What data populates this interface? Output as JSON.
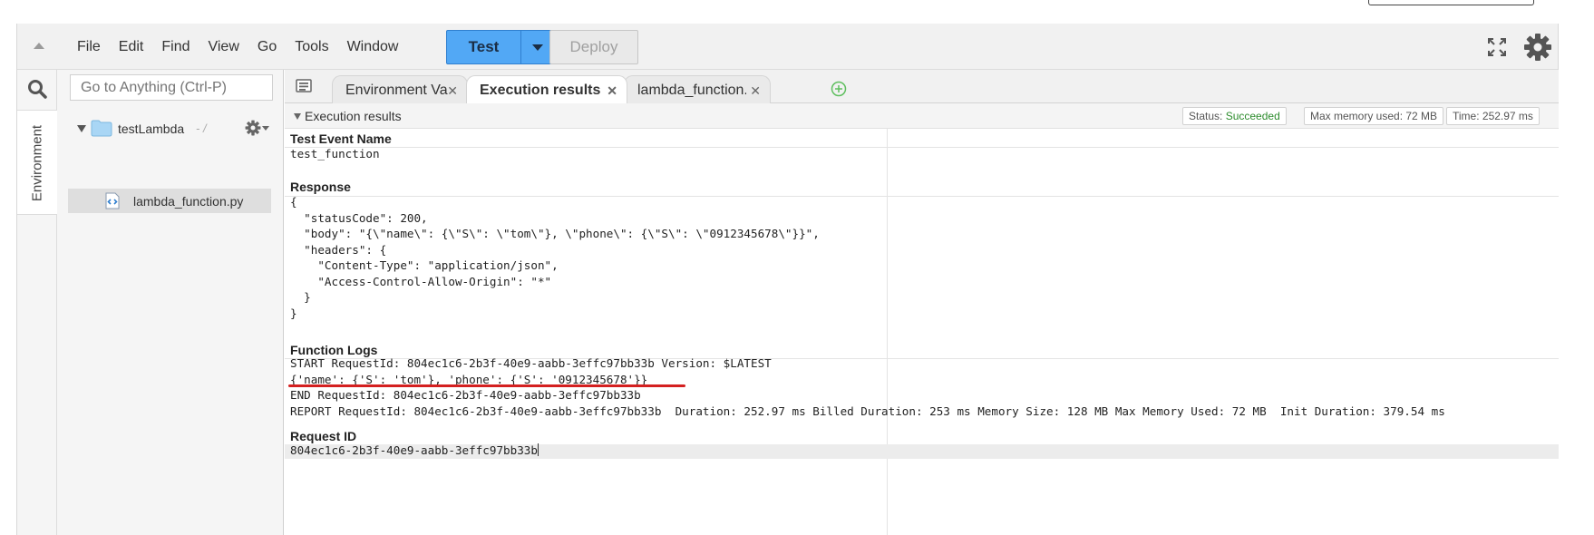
{
  "menubar": {
    "items": [
      "File",
      "Edit",
      "Find",
      "View",
      "Go",
      "Tools",
      "Window"
    ],
    "test_label": "Test",
    "deploy_label": "Deploy"
  },
  "rail": {
    "environment_tab": "Environment"
  },
  "tree": {
    "goto_placeholder": "Go to Anything (Ctrl-P)",
    "root_name": "testLambda",
    "root_sep": "- /",
    "file_name": "lambda_function.py"
  },
  "tabs": [
    {
      "label": "Environment Vari",
      "active": false
    },
    {
      "label": "Execution results",
      "active": true
    },
    {
      "label": "lambda_function.",
      "active": false
    }
  ],
  "results": {
    "title": "Execution results",
    "status_label": "Status:",
    "status_value": "Succeeded",
    "memory": "Max memory used: 72 MB",
    "time": "Time: 252.97 ms"
  },
  "sections": {
    "test_event_name_title": "Test Event Name",
    "test_event_name_value": "test_function",
    "response_title": "Response",
    "response_body": "{\n  \"statusCode\": 200,\n  \"body\": \"{\\\"name\\\": {\\\"S\\\": \\\"tom\\\"}, \\\"phone\\\": {\\\"S\\\": \\\"0912345678\\\"}}\",\n  \"headers\": {\n    \"Content-Type\": \"application/json\",\n    \"Access-Control-Allow-Origin\": \"*\"\n  }\n}",
    "function_logs_title": "Function Logs",
    "function_logs": "START RequestId: 804ec1c6-2b3f-40e9-aabb-3effc97bb33b Version: $LATEST\n{'name': {'S': 'tom'}, 'phone': {'S': '0912345678'}}\nEND RequestId: 804ec1c6-2b3f-40e9-aabb-3effc97bb33b\nREPORT RequestId: 804ec1c6-2b3f-40e9-aabb-3effc97bb33b  Duration: 252.97 ms Billed Duration: 253 ms Memory Size: 128 MB Max Memory Used: 72 MB  Init Duration: 379.54 ms",
    "request_id_title": "Request ID",
    "request_id_value": "804ec1c6-2b3f-40e9-aabb-3effc97bb33b"
  },
  "colors": {
    "test_button": "#52a8f5",
    "status_ok": "#2d8c2d",
    "underline": "#d42020"
  }
}
